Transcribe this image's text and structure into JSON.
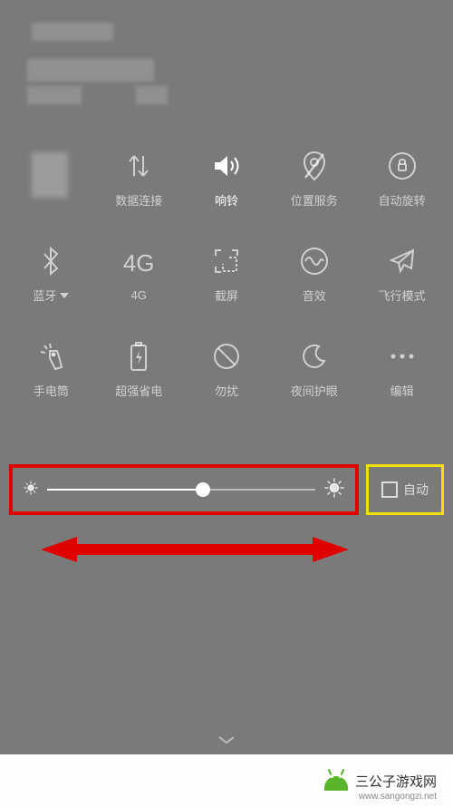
{
  "tiles": [
    {
      "label": "",
      "icon": "blurred"
    },
    {
      "label": "数据连接",
      "icon": "data"
    },
    {
      "label": "响铃",
      "icon": "ring",
      "active": true
    },
    {
      "label": "位置服务",
      "icon": "location"
    },
    {
      "label": "自动旋转",
      "icon": "rotate"
    },
    {
      "label": "蓝牙",
      "icon": "bluetooth",
      "caret": true
    },
    {
      "label": "4G",
      "icon": "4g"
    },
    {
      "label": "截屏",
      "icon": "screenshot"
    },
    {
      "label": "音效",
      "icon": "sound"
    },
    {
      "label": "飞行模式",
      "icon": "airplane"
    },
    {
      "label": "手电筒",
      "icon": "flashlight"
    },
    {
      "label": "超强省电",
      "icon": "battery"
    },
    {
      "label": "勿扰",
      "icon": "dnd"
    },
    {
      "label": "夜间护眼",
      "icon": "night"
    },
    {
      "label": "编辑",
      "icon": "edit"
    }
  ],
  "brightness": {
    "value_percent": 58,
    "auto_label": "自动",
    "auto_checked": false
  },
  "footer": {
    "brand": "三公子游戏网",
    "url": "www.sangongzi.net"
  },
  "annotation_colors": {
    "slider_highlight": "#e00000",
    "auto_highlight": "#f5e100",
    "arrow": "#e00000"
  }
}
